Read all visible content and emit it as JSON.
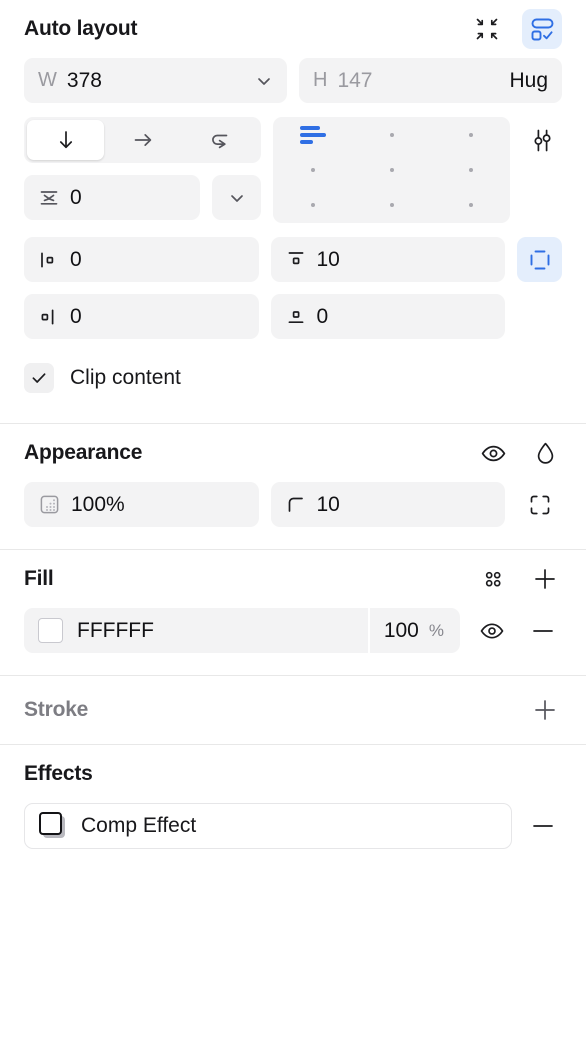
{
  "autolayout": {
    "title": "Auto layout",
    "actions": [
      {
        "name": "collapse-arrows-icon",
        "label": "Collapse"
      },
      {
        "name": "auto-layout-toggle-icon",
        "label": "Auto layout"
      }
    ],
    "width": {
      "label": "W",
      "value": "378"
    },
    "height": {
      "label": "H",
      "value": "147",
      "mode": "Hug"
    },
    "direction": {
      "options": [
        "vertical",
        "horizontal",
        "wrap"
      ],
      "selected": "vertical"
    },
    "alignment": {
      "selected_row": 0,
      "selected_col": 0
    },
    "gap": {
      "value": "0"
    },
    "padding_left": {
      "value": "0"
    },
    "padding_top": {
      "value": "10"
    },
    "padding_right": {
      "value": "0"
    },
    "padding_bottom": {
      "value": "0"
    },
    "clip_content": {
      "label": "Clip content",
      "checked": true
    },
    "advanced_icon": "sliders-icon",
    "individual_padding_icon": "individual-padding-icon"
  },
  "appearance": {
    "title": "Appearance",
    "visibility_icon": "eye-icon",
    "blend_icon": "droplet-icon",
    "opacity": {
      "value": "100%"
    },
    "corner_radius": {
      "value": "10"
    },
    "independent_corners_icon": "independent-corners-icon"
  },
  "fill": {
    "title": "Fill",
    "styles_icon": "four-dots-icon",
    "add_icon": "plus-icon",
    "items": [
      {
        "color": "FFFFFF",
        "swatch_hex": "#FFFFFF",
        "opacity": "100",
        "unit": "%",
        "visibility_icon": "eye-icon",
        "remove_icon": "minus-icon"
      }
    ]
  },
  "stroke": {
    "title": "Stroke",
    "add_icon": "plus-icon"
  },
  "effects": {
    "title": "Effects",
    "items": [
      {
        "label": "Comp Effect",
        "effect_icon": "drop-shadow-icon",
        "remove_icon": "minus-icon"
      }
    ]
  },
  "colors": {
    "accent": "#2f6fe4",
    "accent_bg": "#e4eefc",
    "field_bg": "#f3f3f4",
    "divider": "#e8e8e8",
    "text": "#18181b",
    "muted": "#9a9aa0"
  }
}
